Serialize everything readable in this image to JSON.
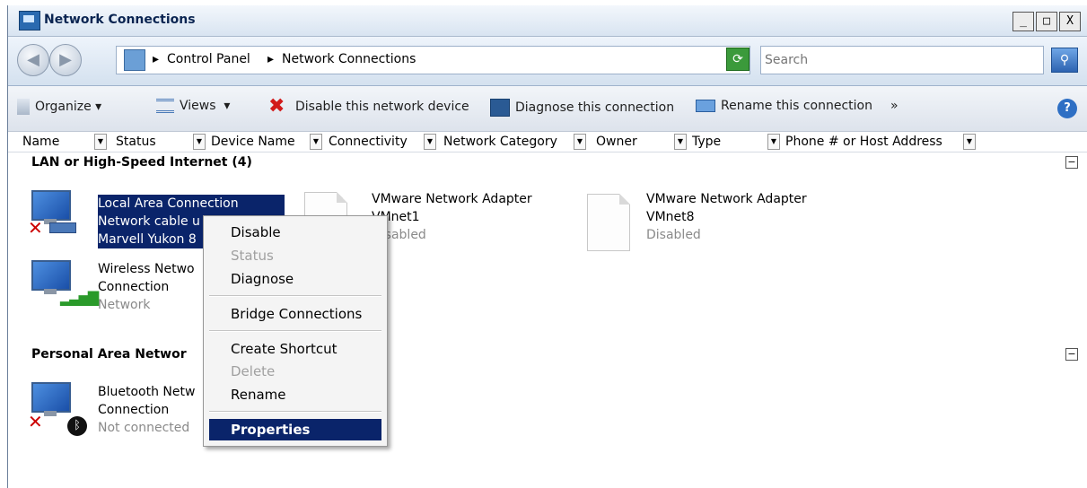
{
  "window": {
    "title": "Network Connections",
    "buttons": [
      "_",
      "□",
      "X"
    ]
  },
  "address": {
    "crumbs": [
      "Control Panel",
      "Network Connections"
    ],
    "search_placeholder": "Search"
  },
  "toolbar": {
    "organize": "Organize",
    "views": "Views",
    "disable": "Disable this network device",
    "diagnose": "Diagnose this connection",
    "rename": "Rename this connection",
    "more": "»"
  },
  "columns": [
    "Name",
    "Status",
    "Device Name",
    "Connectivity",
    "Network Category",
    "Owner",
    "Type",
    "Phone # or Host Address"
  ],
  "groups": {
    "lan": {
      "title": "LAN or High-Speed Internet (4)",
      "collapse": "−"
    },
    "pan": {
      "title": "Personal Area Networ",
      "collapse": "−"
    }
  },
  "items": {
    "local": {
      "line1": "Local Area Connection",
      "line2": "Network cable u",
      "line3": "Marvell Yukon 8"
    },
    "wireless": {
      "line1": "Wireless Netwo",
      "line2": "Connection",
      "line3": "Network"
    },
    "vmnet1": {
      "line1": "VMware Network Adapter",
      "line2": "VMnet1",
      "line3": "Disabled"
    },
    "vmnet8": {
      "line1": "VMware Network Adapter",
      "line2": "VMnet8",
      "line3": "Disabled"
    },
    "bluetooth": {
      "line1": "Bluetooth Netw",
      "line2": "Connection",
      "line3": "Not connected"
    }
  },
  "context_menu": {
    "disable": "Disable",
    "status": "Status",
    "diagnose": "Diagnose",
    "bridge": "Bridge Connections",
    "shortcut": "Create Shortcut",
    "delete": "Delete",
    "rename": "Rename",
    "properties": "Properties"
  }
}
